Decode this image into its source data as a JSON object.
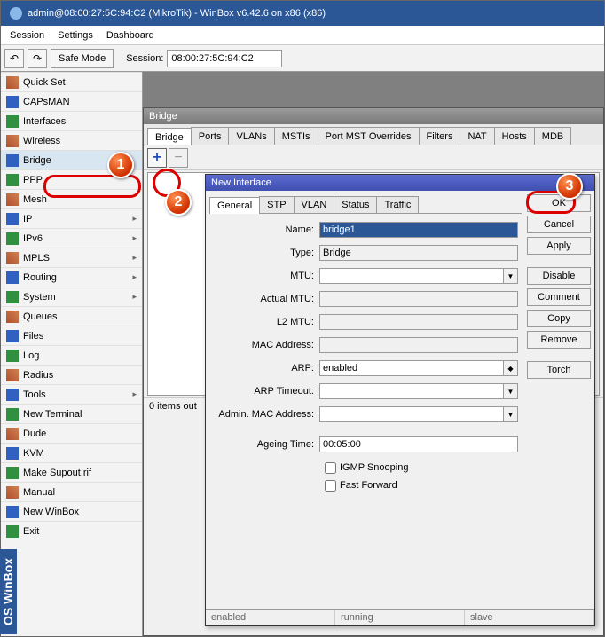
{
  "window": {
    "title": "admin@08:00:27:5C:94:C2 (MikroTik) - WinBox v6.42.6 on x86 (x86)"
  },
  "menu": {
    "session": "Session",
    "settings": "Settings",
    "dashboard": "Dashboard"
  },
  "toolbar": {
    "safemode": "Safe Mode",
    "session_label": "Session:",
    "session_value": "08:00:27:5C:94:C2"
  },
  "sidebar": {
    "items": [
      {
        "label": "Quick Set",
        "arrow": false
      },
      {
        "label": "CAPsMAN",
        "arrow": false
      },
      {
        "label": "Interfaces",
        "arrow": false
      },
      {
        "label": "Wireless",
        "arrow": false
      },
      {
        "label": "Bridge",
        "arrow": false,
        "selected": true
      },
      {
        "label": "PPP",
        "arrow": false
      },
      {
        "label": "Mesh",
        "arrow": false
      },
      {
        "label": "IP",
        "arrow": true
      },
      {
        "label": "IPv6",
        "arrow": true
      },
      {
        "label": "MPLS",
        "arrow": true
      },
      {
        "label": "Routing",
        "arrow": true
      },
      {
        "label": "System",
        "arrow": true
      },
      {
        "label": "Queues",
        "arrow": false
      },
      {
        "label": "Files",
        "arrow": false
      },
      {
        "label": "Log",
        "arrow": false
      },
      {
        "label": "Radius",
        "arrow": false
      },
      {
        "label": "Tools",
        "arrow": true
      },
      {
        "label": "New Terminal",
        "arrow": false
      },
      {
        "label": "Dude",
        "arrow": false
      },
      {
        "label": "KVM",
        "arrow": false
      },
      {
        "label": "Make Supout.rif",
        "arrow": false
      },
      {
        "label": "Manual",
        "arrow": false
      },
      {
        "label": "New WinBox",
        "arrow": false
      },
      {
        "label": "Exit",
        "arrow": false
      }
    ]
  },
  "bridge_window": {
    "title": "Bridge",
    "tabs": [
      "Bridge",
      "Ports",
      "VLANs",
      "MSTIs",
      "Port MST Overrides",
      "Filters",
      "NAT",
      "Hosts",
      "MDB"
    ],
    "active_tab": 0,
    "status": "0 items out"
  },
  "new_interface": {
    "title": "New Interface",
    "tabs": [
      "General",
      "STP",
      "VLAN",
      "Status",
      "Traffic"
    ],
    "active_tab": 0,
    "fields": {
      "name_label": "Name:",
      "name_value": "bridge1",
      "type_label": "Type:",
      "type_value": "Bridge",
      "mtu_label": "MTU:",
      "mtu_value": "",
      "actual_mtu_label": "Actual MTU:",
      "actual_mtu_value": "",
      "l2mtu_label": "L2 MTU:",
      "l2mtu_value": "",
      "mac_label": "MAC Address:",
      "mac_value": "",
      "arp_label": "ARP:",
      "arp_value": "enabled",
      "arp_timeout_label": "ARP Timeout:",
      "arp_timeout_value": "",
      "admin_mac_label": "Admin. MAC Address:",
      "admin_mac_value": "",
      "ageing_label": "Ageing Time:",
      "ageing_value": "00:05:00",
      "igmp_label": "IGMP Snooping",
      "ff_label": "Fast Forward"
    },
    "buttons": {
      "ok": "OK",
      "cancel": "Cancel",
      "apply": "Apply",
      "disable": "Disable",
      "comment": "Comment",
      "copy": "Copy",
      "remove": "Remove",
      "torch": "Torch"
    },
    "status": {
      "enabled": "enabled",
      "running": "running",
      "slave": "slave"
    }
  },
  "markers": {
    "m1": "1",
    "m2": "2",
    "m3": "3"
  },
  "brand": "OS WinBox"
}
